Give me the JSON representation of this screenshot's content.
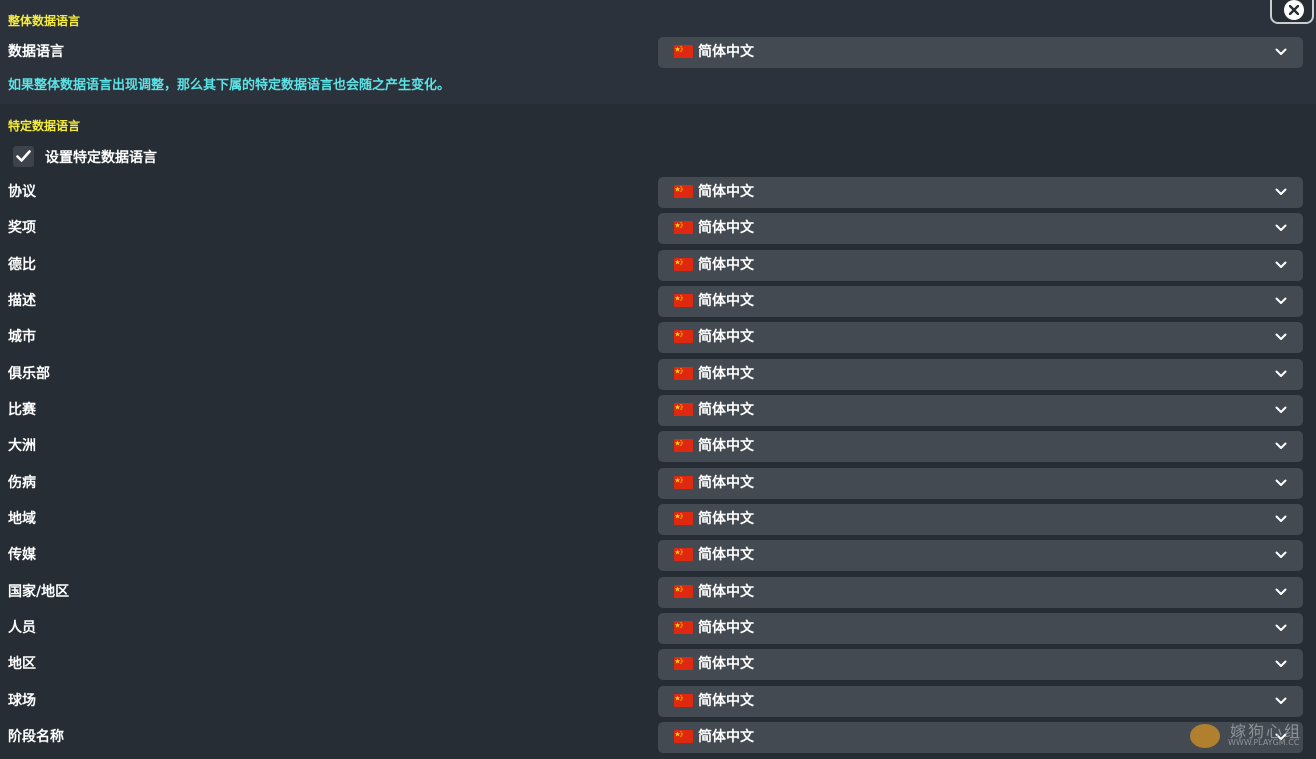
{
  "overall": {
    "section_title": "整体数据语言",
    "label": "数据语言",
    "value": "简体中文",
    "note": "如果整体数据语言出现调整，那么其下属的特定数据语言也会随之产生变化。"
  },
  "specific": {
    "section_title": "特定数据语言",
    "checkbox_label": "设置特定数据语言",
    "checkbox_checked": true,
    "rows": [
      {
        "label": "协议",
        "value": "简体中文"
      },
      {
        "label": "奖项",
        "value": "简体中文"
      },
      {
        "label": "德比",
        "value": "简体中文"
      },
      {
        "label": "描述",
        "value": "简体中文"
      },
      {
        "label": "城市",
        "value": "简体中文"
      },
      {
        "label": "俱乐部",
        "value": "简体中文"
      },
      {
        "label": "比赛",
        "value": "简体中文"
      },
      {
        "label": "大洲",
        "value": "简体中文"
      },
      {
        "label": "伤病",
        "value": "简体中文"
      },
      {
        "label": "地域",
        "value": "简体中文"
      },
      {
        "label": "传媒",
        "value": "简体中文"
      },
      {
        "label": "国家/地区",
        "value": "简体中文"
      },
      {
        "label": "人员",
        "value": "简体中文"
      },
      {
        "label": "地区",
        "value": "简体中文"
      },
      {
        "label": "球场",
        "value": "简体中文"
      },
      {
        "label": "阶段名称",
        "value": "简体中文"
      }
    ]
  },
  "watermark": {
    "text": "嫁狗心组",
    "url": "WWW.PLAYGM.CC"
  },
  "icons": {
    "close": "close-icon",
    "chevron": "chevron-down-icon",
    "flag": "china-flag-icon",
    "check": "checkmark-icon"
  },
  "colors": {
    "background": "#262d35",
    "section_title": "#f5ec3b",
    "note": "#5ce3e6",
    "dropdown": "#444a51",
    "flag_red": "#de2910",
    "flag_star": "#ffde00"
  }
}
